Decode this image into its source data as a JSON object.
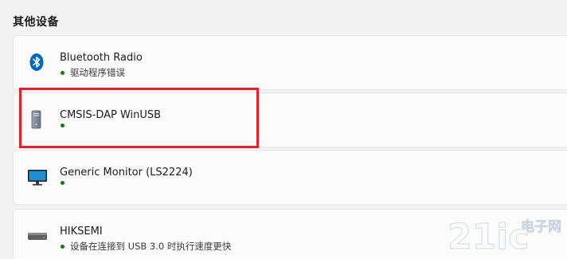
{
  "section": {
    "title": "其他设备"
  },
  "colors": {
    "status_ok": "#107c10",
    "highlight": "#e0222a",
    "bluetooth": "#0067c0"
  },
  "devices": [
    {
      "name": "Bluetooth Radio",
      "status": "驱动程序错误",
      "icon": "bluetooth-icon"
    },
    {
      "name": "CMSIS-DAP WinUSB",
      "status": "",
      "icon": "device-tower-icon"
    },
    {
      "name": "Generic Monitor (LS2224)",
      "status": "",
      "icon": "monitor-icon"
    },
    {
      "name": "HIKSEMI",
      "status": "设备在连接到 USB 3.0 时执行速度更快",
      "icon": "drive-icon"
    }
  ],
  "watermark": {
    "text_main": "21ic",
    "text_side": "电子网"
  }
}
